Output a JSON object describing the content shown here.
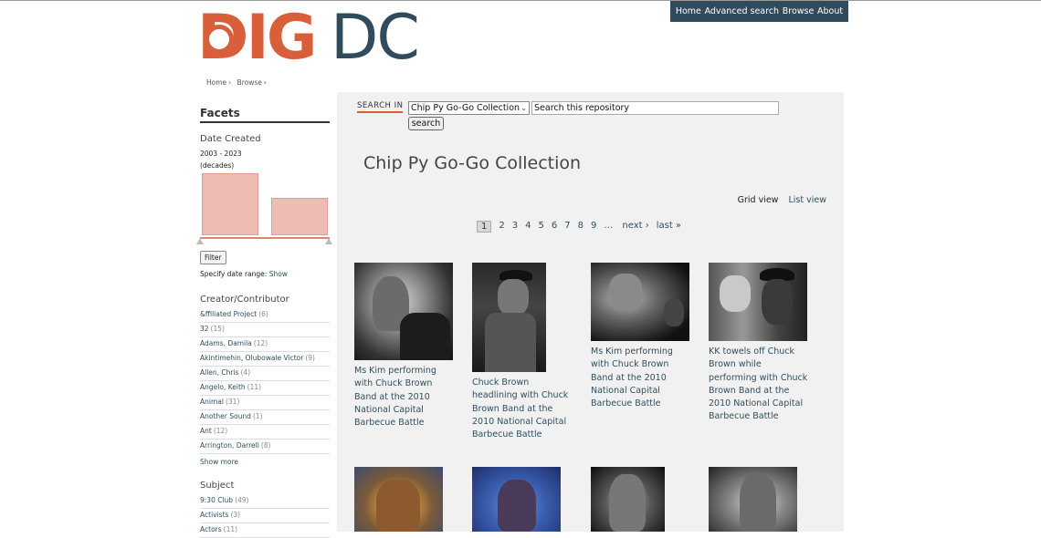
{
  "logo": {
    "part1": "DIG",
    "part2": "DC"
  },
  "nav": [
    "Home",
    "Advanced search",
    "Browse",
    "About"
  ],
  "breadcrumb": [
    "Home",
    "Browse"
  ],
  "sidebar": {
    "title": "Facets",
    "date": {
      "heading": "Date Created",
      "range": "2003 - 2023",
      "unit": "(decades)",
      "bars": [
        1.0,
        0.6
      ]
    },
    "filter_label": "Filter",
    "range_text": "Specify date range:",
    "range_link": "Show",
    "creator": {
      "heading": "Creator/Contributor",
      "items": [
        {
          "label": "&ffiliated Project",
          "count": "(6)"
        },
        {
          "label": "32",
          "count": "(15)"
        },
        {
          "label": "Adams, Damila",
          "count": "(12)"
        },
        {
          "label": "Akintimehin, Olubowale Victor",
          "count": "(9)"
        },
        {
          "label": "Allen, Chris",
          "count": "(4)"
        },
        {
          "label": "Angelo, Keith",
          "count": "(11)"
        },
        {
          "label": "Animal",
          "count": "(31)"
        },
        {
          "label": "Another Sound",
          "count": "(1)"
        },
        {
          "label": "Ant",
          "count": "(12)"
        },
        {
          "label": "Arrington, Darrell",
          "count": "(8)"
        }
      ],
      "show_more": "Show more"
    },
    "subject": {
      "heading": "Subject",
      "items": [
        {
          "label": "9:30 Club",
          "count": "(49)"
        },
        {
          "label": "Activists",
          "count": "(3)"
        },
        {
          "label": "Actors",
          "count": "(11)"
        }
      ]
    }
  },
  "search": {
    "label": "SEARCH IN",
    "select_value": "Chip Py Go-Go Collection",
    "input_value": "Search this repository",
    "button": "search"
  },
  "collection_title": "Chip Py Go-Go Collection",
  "views": {
    "grid": "Grid view",
    "list": "List view"
  },
  "pager": {
    "pages": [
      "1",
      "2",
      "3",
      "4",
      "5",
      "6",
      "7",
      "8",
      "9"
    ],
    "current": "1",
    "ellipsis": "…",
    "next": "next ›",
    "last": "last »"
  },
  "items": [
    {
      "caption": "Ms Kim performing with Chuck Brown Band at the 2010 National Capital Barbecue Battle"
    },
    {
      "caption": "Chuck Brown headlining with Chuck Brown Band at the 2010 National Capital Barbecue Battle"
    },
    {
      "caption": "Ms Kim performing with Chuck Brown Band at the 2010 National Capital Barbecue Battle"
    },
    {
      "caption": "KK towels off Chuck Brown while performing with Chuck Brown Band at the 2010 National Capital Barbecue Battle"
    },
    {
      "caption": ""
    },
    {
      "caption": ""
    },
    {
      "caption": ""
    },
    {
      "caption": ""
    }
  ]
}
